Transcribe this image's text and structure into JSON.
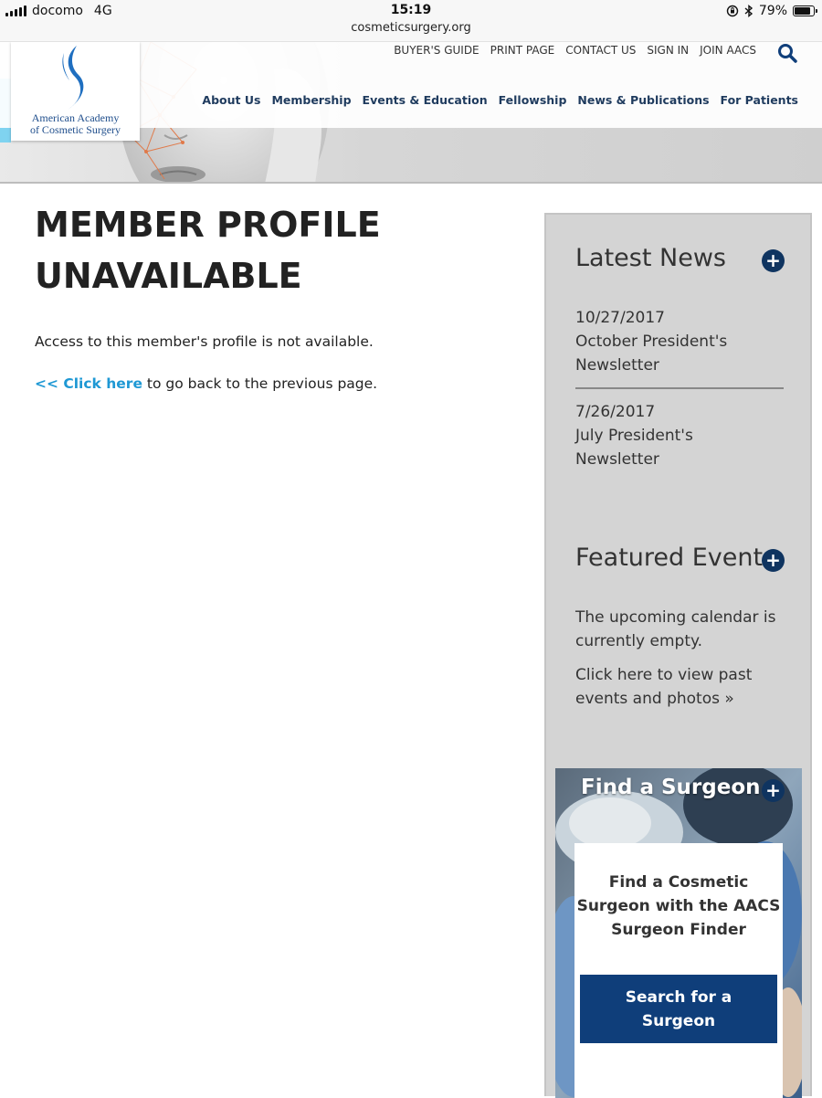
{
  "status_bar": {
    "carrier": "docomo",
    "network": "4G",
    "time": "15:19",
    "url": "cosmeticsurgery.org",
    "battery": "79%"
  },
  "logo": {
    "line1": "American Academy",
    "line2": "of Cosmetic Surgery"
  },
  "utility_nav": [
    "BUYER'S GUIDE",
    "PRINT PAGE",
    "CONTACT US",
    "SIGN IN",
    "JOIN AACS"
  ],
  "main_nav": [
    "About Us",
    "Membership",
    "Events & Education",
    "Fellowship",
    "News & Publications",
    "For Patients"
  ],
  "main": {
    "title_line1": "MEMBER PROFILE",
    "title_line2": "UNAVAILABLE",
    "message": "Access to this member's profile is not available.",
    "back_link": "<< Click here",
    "back_text": " to go back to the previous page."
  },
  "sidebar": {
    "latest_news": {
      "title": "Latest News",
      "items": [
        {
          "date": "10/27/2017",
          "title_line1": "October President's",
          "title_line2": "Newsletter"
        },
        {
          "date": "7/26/2017",
          "title_line1": "July President's",
          "title_line2": "Newsletter"
        }
      ]
    },
    "featured_events": {
      "title": "Featured Event",
      "empty_line1": "The upcoming calendar is",
      "empty_line2": "currently empty.",
      "past_line1": "Click here to view past",
      "past_line2": "events and photos »"
    },
    "find_surgeon": {
      "title": "Find a Surgeon",
      "text_line1": "Find a Cosmetic",
      "text_line2": "Surgeon with the AACS",
      "text_line3": "Surgeon Finder",
      "button_line1": "Search for a",
      "button_line2": "Surgeon"
    }
  },
  "colors": {
    "nav_text": "#1f3b5e",
    "link": "#1e98d4",
    "plus_button": "#0f3460",
    "search_button": "#0f3e7a",
    "sidebar_bg": "#d4d4d4"
  }
}
